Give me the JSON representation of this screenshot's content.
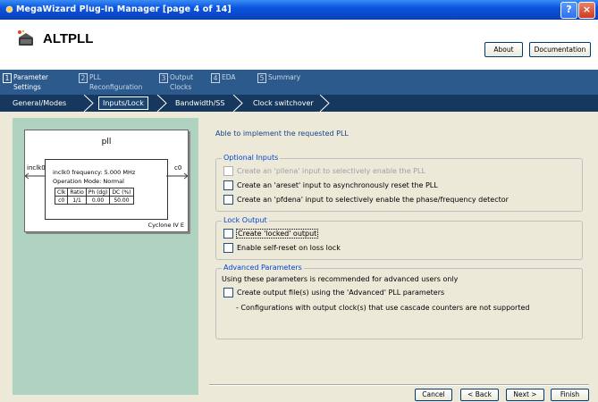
{
  "window": {
    "title": "MegaWizard Plug-In Manager [page 4 of 14]",
    "help_label": "?",
    "close_label": "×"
  },
  "header": {
    "title": "ALTPLL",
    "about_label": "About",
    "documentation_label": "Documentation"
  },
  "tabs": [
    {
      "num": "1",
      "label": "Parameter",
      "sub": "Settings",
      "active": true
    },
    {
      "num": "2",
      "label": "PLL",
      "sub": "Reconfiguration",
      "active": false
    },
    {
      "num": "3",
      "label": "Output",
      "sub": "Clocks",
      "active": false
    },
    {
      "num": "4",
      "label": "EDA",
      "sub": "",
      "active": false
    },
    {
      "num": "5",
      "label": "Summary",
      "sub": "",
      "active": false
    }
  ],
  "subtabs": [
    {
      "label": "General/Modes",
      "active": false
    },
    {
      "label": "Inputs/Lock",
      "active": true
    },
    {
      "label": "Bandwidth/SS",
      "active": false
    },
    {
      "label": "Clock switchover",
      "active": false
    }
  ],
  "diagram": {
    "name": "pll",
    "input": "inclk0",
    "output": "c0",
    "freq_line": "inclk0 frequency: 5.000 MHz",
    "mode_line": "Operation Mode: Normal",
    "table_headers": [
      "Clk",
      "Ratio",
      "Ph (dg)",
      "DC (%)"
    ],
    "table_rows": [
      [
        "c0",
        "1/1",
        "0.00",
        "50.00"
      ]
    ],
    "family": "Cyclone IV E"
  },
  "status_message": "Able to implement the requested PLL",
  "optional_inputs": {
    "legend": "Optional Inputs",
    "options": [
      {
        "label": "Create an 'pllena' input to selectively enable the PLL",
        "checked": false,
        "disabled": true
      },
      {
        "label": "Create an 'areset' input to asynchronously reset the PLL",
        "checked": false,
        "disabled": false
      },
      {
        "label": "Create an 'pfdena' input to selectively enable the phase/frequency detector",
        "checked": false,
        "disabled": false
      }
    ]
  },
  "lock_output": {
    "legend": "Lock Output",
    "options": [
      {
        "label": "Create 'locked' output",
        "checked": false
      },
      {
        "label": "Enable self-reset on loss lock",
        "checked": false
      }
    ]
  },
  "advanced": {
    "legend": "Advanced Parameters",
    "description": "Using these parameters is recommended for advanced users only",
    "option_label": "Create output file(s) using the 'Advanced' PLL parameters",
    "note": "- Configurations with output clock(s) that use cascade counters are not supported"
  },
  "footer": {
    "cancel_label": "Cancel",
    "back_label": "< Back",
    "next_label": "Next >",
    "finish_label": "Finish"
  }
}
